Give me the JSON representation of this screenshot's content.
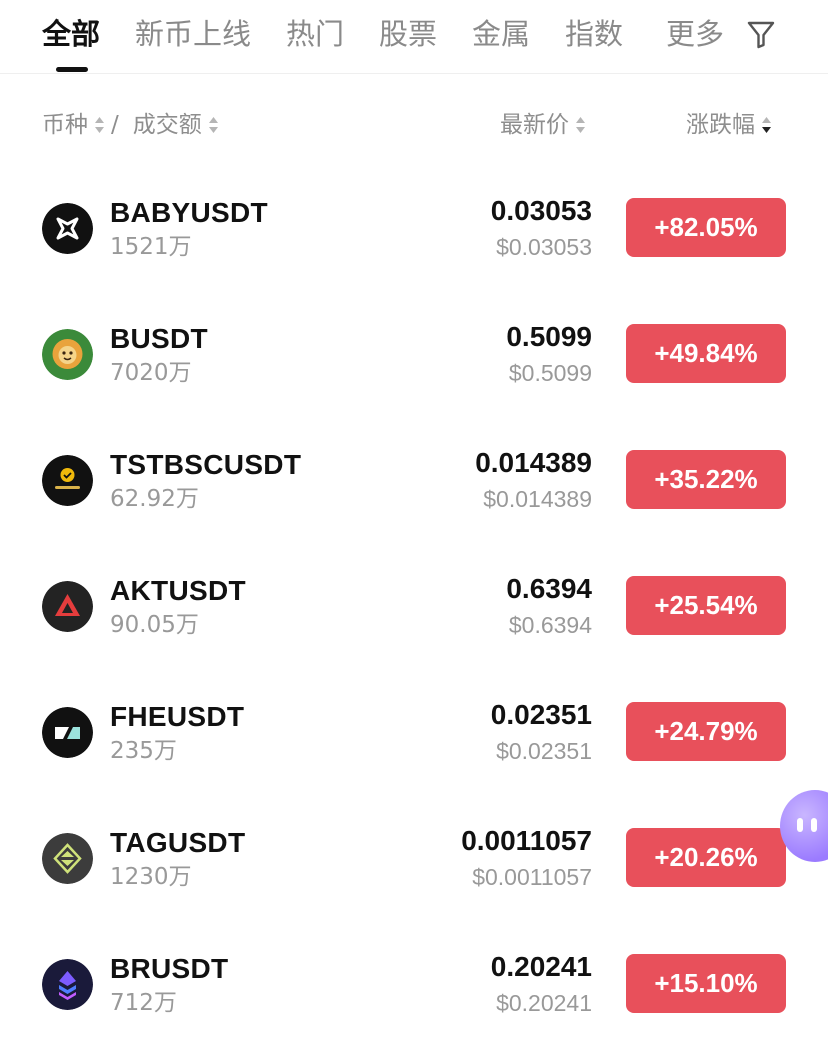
{
  "tabs": [
    {
      "label": "全部",
      "active": true
    },
    {
      "label": "新币上线",
      "active": false
    },
    {
      "label": "热门",
      "active": false
    },
    {
      "label": "股票",
      "active": false
    },
    {
      "label": "金属",
      "active": false
    },
    {
      "label": "指数",
      "active": false
    },
    {
      "label": "更多",
      "active": false
    }
  ],
  "filter_icon": "filter-icon",
  "columns": {
    "coin": "币种",
    "separator": "/",
    "volume": "成交额",
    "price": "最新价",
    "change": "涨跌幅"
  },
  "colors": {
    "positive": "#e8505b",
    "text_primary": "#111111",
    "text_secondary": "#999999"
  },
  "rows": [
    {
      "symbol": "BABYUSDT",
      "volume": "1521万",
      "price": "0.03053",
      "price_usd": "$0.03053",
      "change": "+82.05%",
      "icon": "baby-coin-icon"
    },
    {
      "symbol": "BUSDT",
      "volume": "7020万",
      "price": "0.5099",
      "price_usd": "$0.5099",
      "change": "+49.84%",
      "icon": "b-coin-icon"
    },
    {
      "symbol": "TSTBSCUSDT",
      "volume": "62.92万",
      "price": "0.014389",
      "price_usd": "$0.014389",
      "change": "+35.22%",
      "icon": "tst-coin-icon"
    },
    {
      "symbol": "AKTUSDT",
      "volume": "90.05万",
      "price": "0.6394",
      "price_usd": "$0.6394",
      "change": "+25.54%",
      "icon": "akt-coin-icon"
    },
    {
      "symbol": "FHEUSDT",
      "volume": "235万",
      "price": "0.02351",
      "price_usd": "$0.02351",
      "change": "+24.79%",
      "icon": "fhe-coin-icon"
    },
    {
      "symbol": "TAGUSDT",
      "volume": "1230万",
      "price": "0.0011057",
      "price_usd": "$0.0011057",
      "change": "+20.26%",
      "icon": "tag-coin-icon"
    },
    {
      "symbol": "BRUSDT",
      "volume": "712万",
      "price": "0.20241",
      "price_usd": "$0.20241",
      "change": "+15.10%",
      "icon": "br-coin-icon"
    }
  ]
}
